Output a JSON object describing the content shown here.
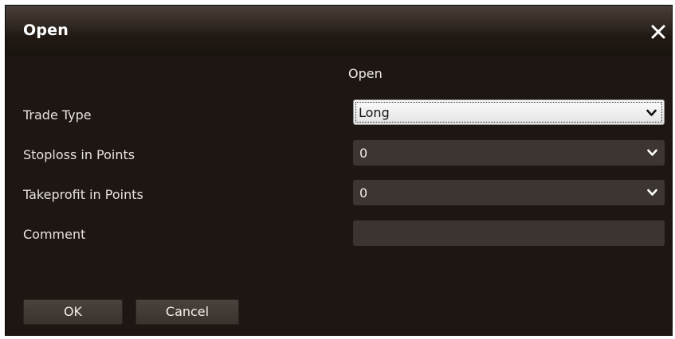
{
  "dialog": {
    "title": "Open",
    "close_icon": "close-icon"
  },
  "form": {
    "header": "Open",
    "rows": [
      {
        "label": "Trade Type",
        "value": "Long",
        "type": "dropdown",
        "focused": true
      },
      {
        "label": "Stoploss in Points",
        "value": "0",
        "type": "dropdown"
      },
      {
        "label": "Takeprofit in Points",
        "value": "0",
        "type": "dropdown"
      },
      {
        "label": "Comment",
        "value": "",
        "type": "text"
      }
    ]
  },
  "buttons": {
    "ok": "OK",
    "cancel": "Cancel"
  },
  "colors": {
    "dialog_bg": "#1d1612",
    "field_bg": "#3d3531",
    "text": "#e7e2dd"
  }
}
